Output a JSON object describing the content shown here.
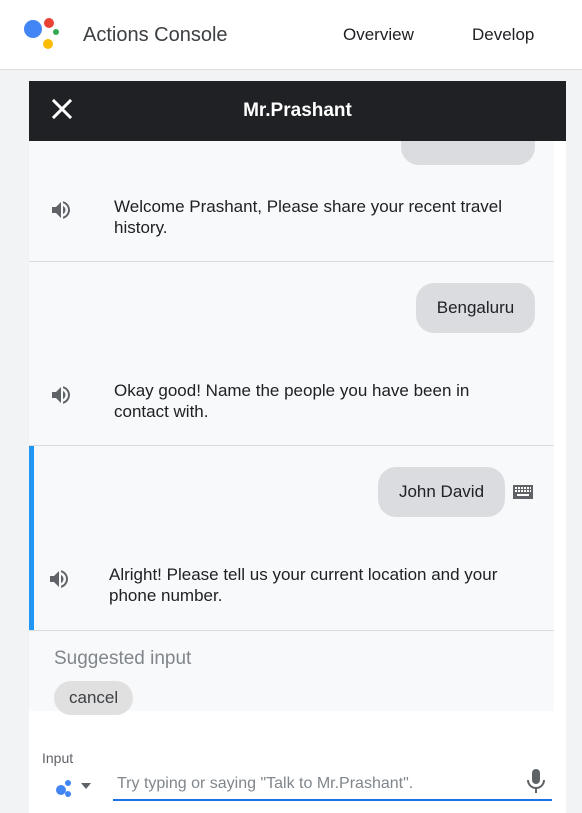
{
  "header": {
    "app_title": "Actions Console",
    "nav": [
      "Overview",
      "Develop"
    ]
  },
  "simulator": {
    "title": "Mr.Prashant",
    "turns": [
      {
        "user": "",
        "bot": "Welcome Prashant, Please share your recent travel history."
      },
      {
        "user": "Bengaluru",
        "bot": "Okay good! Name the people you have been in contact with."
      },
      {
        "user": "John David",
        "bot": "Alright! Please tell us your current location and your phone number."
      }
    ],
    "suggested_label": "Suggested input",
    "suggestions": [
      "cancel"
    ],
    "input_label": "Input",
    "input_placeholder": "Try typing or saying \"Talk to Mr.Prashant\"."
  },
  "colors": {
    "assistant_blue": "#4285f4",
    "assistant_red": "#ea4335",
    "assistant_yellow": "#fbbc04",
    "assistant_green": "#34a853",
    "active_turn_accent": "#2196f3",
    "input_underline": "#1a73e8"
  },
  "icons": [
    "google-assistant-logo",
    "close-icon",
    "speaker-icon",
    "keyboard-icon",
    "chevron-down-icon",
    "mic-icon"
  ]
}
